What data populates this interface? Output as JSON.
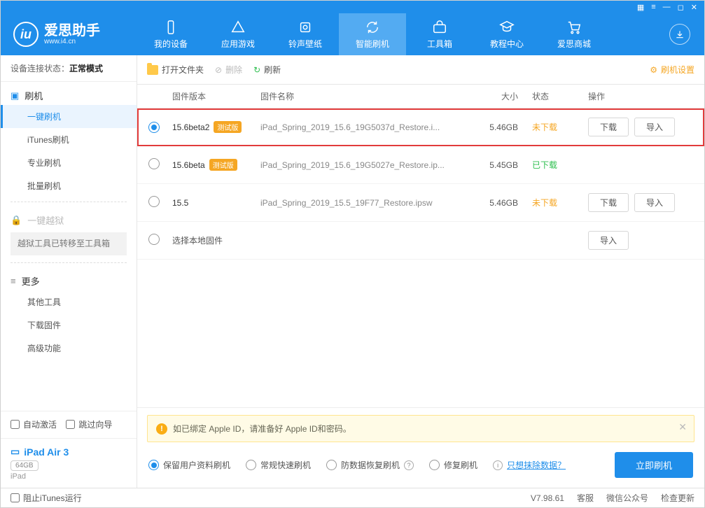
{
  "window_controls": [
    "▦",
    "≡",
    "—",
    "◻",
    "✕"
  ],
  "logo": {
    "title": "爱思助手",
    "sub": "www.i4.cn"
  },
  "tabs": [
    {
      "id": "device",
      "label": "我的设备"
    },
    {
      "id": "apps",
      "label": "应用游戏"
    },
    {
      "id": "ring",
      "label": "铃声壁纸"
    },
    {
      "id": "flash",
      "label": "智能刷机",
      "active": true
    },
    {
      "id": "tools",
      "label": "工具箱"
    },
    {
      "id": "tutorial",
      "label": "教程中心"
    },
    {
      "id": "store",
      "label": "爱思商城"
    }
  ],
  "sidebar": {
    "status_label": "设备连接状态：",
    "status_value": "正常模式",
    "groups": {
      "flash": {
        "label": "刷机",
        "items": [
          {
            "id": "oneclick",
            "label": "一键刷机",
            "active": true
          },
          {
            "id": "itunes",
            "label": "iTunes刷机"
          },
          {
            "id": "pro",
            "label": "专业刷机"
          },
          {
            "id": "batch",
            "label": "批量刷机"
          }
        ]
      },
      "jailbreak": {
        "label": "一键越狱",
        "note": "越狱工具已转移至工具箱"
      },
      "more": {
        "label": "更多",
        "items": [
          {
            "id": "other",
            "label": "其他工具"
          },
          {
            "id": "dlfw",
            "label": "下载固件"
          },
          {
            "id": "adv",
            "label": "高级功能"
          }
        ]
      }
    },
    "auto_activate": "自动激活",
    "skip_guide": "跳过向导",
    "device": {
      "name": "iPad Air 3",
      "storage": "64GB",
      "type": "iPad"
    }
  },
  "toolbar": {
    "open": "打开文件夹",
    "delete": "删除",
    "refresh": "刷新",
    "settings": "刷机设置"
  },
  "table": {
    "headers": {
      "version": "固件版本",
      "name": "固件名称",
      "size": "大小",
      "status": "状态",
      "ops": "操作"
    },
    "op_download": "下载",
    "op_import": "导入",
    "local_label": "选择本地固件",
    "rows": [
      {
        "selected": true,
        "highlight": true,
        "version": "15.6beta2",
        "beta": "测试版",
        "name": "iPad_Spring_2019_15.6_19G5037d_Restore.i...",
        "size": "5.46GB",
        "status": "未下载",
        "status_cls": "nd",
        "ops": [
          "download",
          "import"
        ]
      },
      {
        "selected": false,
        "version": "15.6beta",
        "beta": "测试版",
        "name": "iPad_Spring_2019_15.6_19G5027e_Restore.ip...",
        "size": "5.45GB",
        "status": "已下载",
        "status_cls": "dl",
        "ops": []
      },
      {
        "selected": false,
        "version": "15.5",
        "name": "iPad_Spring_2019_15.5_19F77_Restore.ipsw",
        "size": "5.46GB",
        "status": "未下载",
        "status_cls": "nd",
        "ops": [
          "download",
          "import"
        ]
      }
    ]
  },
  "warning": "如已绑定 Apple ID，请准备好 Apple ID和密码。",
  "modes": [
    {
      "id": "keep",
      "label": "保留用户资料刷机",
      "selected": true
    },
    {
      "id": "normal",
      "label": "常规快速刷机"
    },
    {
      "id": "recover",
      "label": "防数据恢复刷机",
      "info": true
    },
    {
      "id": "repair",
      "label": "修复刷机"
    }
  ],
  "erase_link": "只想抹除数据？",
  "flash_btn": "立即刷机",
  "footer": {
    "block_itunes": "阻止iTunes运行",
    "version": "V7.98.61",
    "support": "客服",
    "wechat": "微信公众号",
    "update": "检查更新"
  }
}
